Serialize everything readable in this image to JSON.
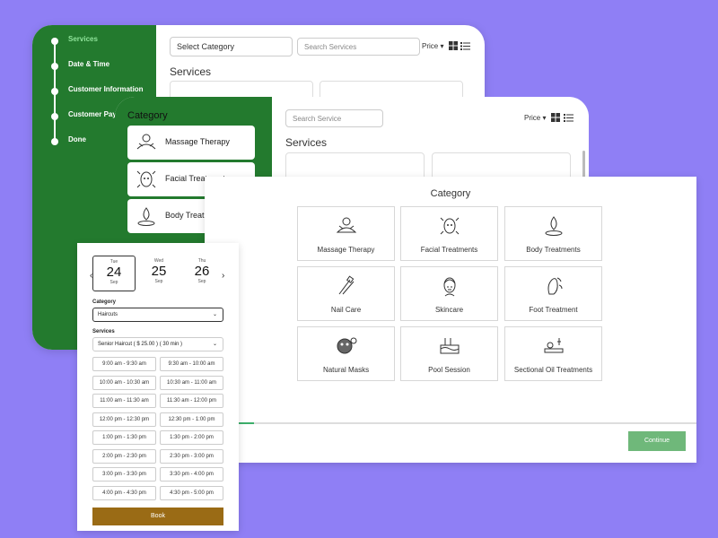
{
  "colors": {
    "background": "#8f7ff5",
    "sidebar_green": "#237a2e",
    "active_step": "#8fe39a",
    "continue_button": "#6fb87a",
    "book_button": "#9a6b15",
    "progress_fill": "#3cae6a"
  },
  "panel_back": {
    "steps": [
      {
        "label": "Services",
        "active": true
      },
      {
        "label": "Date & Time",
        "active": false
      },
      {
        "label": "Customer Information",
        "active": false
      },
      {
        "label": "Customer Paym",
        "active": false
      },
      {
        "label": "Done",
        "active": false
      }
    ],
    "select_category": "Select Category",
    "search_placeholder": "Search Services",
    "price_label": "Price",
    "section_title": "Services"
  },
  "panel_middle": {
    "category_title": "Category",
    "categories": [
      {
        "label": "Massage Therapy",
        "icon": "massage-icon"
      },
      {
        "label": "Facial Treatments",
        "icon": "facial-icon"
      },
      {
        "label": "Body Treatments",
        "icon": "body-icon"
      }
    ],
    "search_placeholder": "Search Service",
    "price_label": "Price",
    "section_title": "Services"
  },
  "panel_front": {
    "title": "Category",
    "tiles": [
      {
        "label": "Massage Therapy",
        "icon": "massage-icon"
      },
      {
        "label": "Facial Treatments",
        "icon": "facial-icon"
      },
      {
        "label": "Body Treatments",
        "icon": "body-icon"
      },
      {
        "label": "Nail Care",
        "icon": "nail-icon"
      },
      {
        "label": "Skincare",
        "icon": "skincare-icon"
      },
      {
        "label": "Foot Treatment",
        "icon": "foot-icon"
      },
      {
        "label": "Natural Masks",
        "icon": "mask-icon"
      },
      {
        "label": "Pool Session",
        "icon": "pool-icon"
      },
      {
        "label": "Sectional Oil Treatments",
        "icon": "oil-icon"
      }
    ],
    "progress_fraction": 0.1,
    "continue_label": "Continue"
  },
  "panel_booking": {
    "dates": [
      {
        "dow": "Tue",
        "day": "24",
        "month": "Sep",
        "selected": true
      },
      {
        "dow": "Wed",
        "day": "25",
        "month": "Sep",
        "selected": false
      },
      {
        "dow": "Thu",
        "day": "26",
        "month": "Sep",
        "selected": false
      }
    ],
    "category_label": "Category",
    "category_value": "Haircuts",
    "services_label": "Services",
    "service_value": "Senior Haircut ( $ 25.00 ) ( 30 min )",
    "slots": [
      "9:00 am - 9:30 am",
      "9:30 am - 10:00 am",
      "10:00 am - 10:30 am",
      "10:30 am - 11:00 am",
      "11:00 am - 11:30 am",
      "11:30 am - 12:00 pm",
      "12:00 pm - 12:30 pm",
      "12:30 pm - 1:00 pm",
      "1:00 pm - 1:30 pm",
      "1:30 pm - 2:00 pm",
      "2:00 pm - 2:30 pm",
      "2:30 pm - 3:00 pm",
      "3:00 pm - 3:30 pm",
      "3:30 pm - 4:00 pm",
      "4:00 pm - 4:30 pm",
      "4:30 pm - 5:00 pm"
    ],
    "book_label": "Book"
  }
}
